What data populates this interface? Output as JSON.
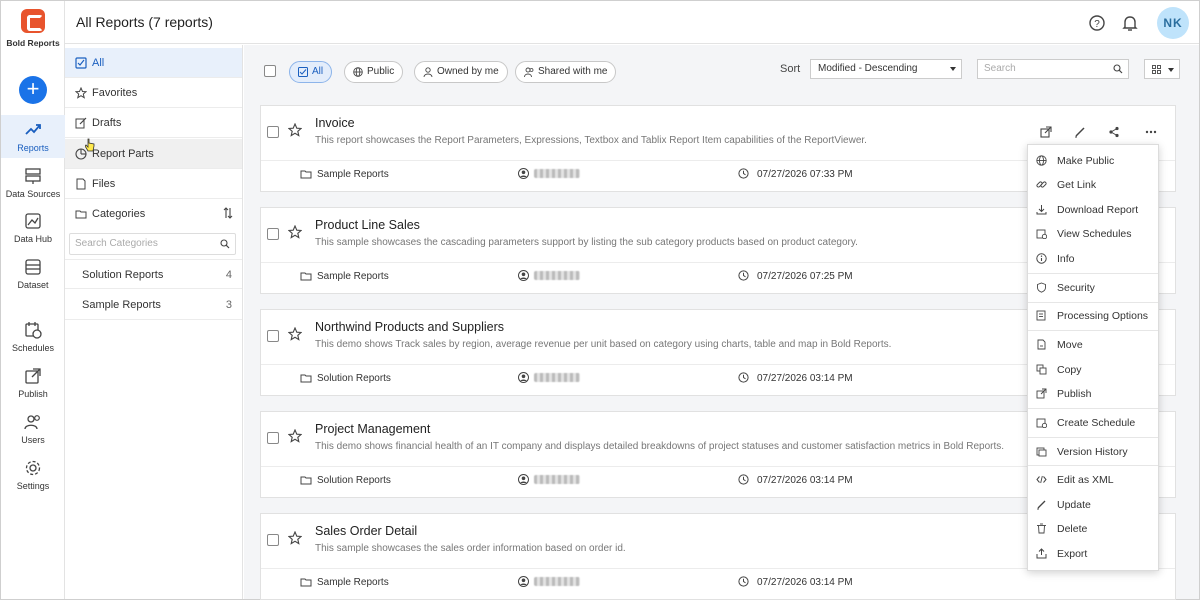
{
  "app": {
    "logo_text": "Bold Reports",
    "accent": "#1a73e8",
    "brand": "#e8542d"
  },
  "rail": {
    "items": [
      {
        "label": "Reports",
        "icon": "trending-up-icon",
        "active": true
      },
      {
        "label": "Data Sources",
        "icon": "data-sources-icon"
      },
      {
        "label": "Data Hub",
        "icon": "data-hub-icon"
      },
      {
        "label": "Dataset",
        "icon": "dataset-icon"
      },
      {
        "label": "Schedules",
        "icon": "schedules-icon"
      },
      {
        "label": "Publish",
        "icon": "publish-icon"
      },
      {
        "label": "Users",
        "icon": "users-icon"
      },
      {
        "label": "Settings",
        "icon": "gear-icon"
      }
    ]
  },
  "header": {
    "title": "All Reports (7 reports)",
    "avatar_initials": "NK"
  },
  "nav": {
    "items": [
      {
        "label": "All",
        "icon": "checkbox-icon"
      },
      {
        "label": "Favorites",
        "icon": "star-icon"
      },
      {
        "label": "Drafts",
        "icon": "edit-icon"
      },
      {
        "label": "Report Parts",
        "icon": "pie-icon"
      },
      {
        "label": "Files",
        "icon": "file-icon"
      },
      {
        "label": "Categories",
        "icon": "folder-icon"
      }
    ],
    "category_search_placeholder": "Search Categories",
    "categories": [
      {
        "name": "Solution Reports",
        "count": "4"
      },
      {
        "name": "Sample Reports",
        "count": "3"
      }
    ]
  },
  "toolbar": {
    "filters": [
      "All",
      "Public",
      "Owned by me",
      "Shared with me"
    ],
    "sort_label": "Sort",
    "sort_value": "Modified - Descending",
    "search_placeholder": "Search"
  },
  "reports": [
    {
      "title": "Invoice",
      "description": "This report showcases the Report Parameters, Expressions, Textbox and Tablix Report Item capabilities of the ReportViewer.",
      "category": "Sample Reports",
      "modified": "07/27/2026 07:33 PM"
    },
    {
      "title": "Product Line Sales",
      "description": "This sample showcases the cascading parameters support by listing the sub category products based on product category.",
      "category": "Sample Reports",
      "modified": "07/27/2026 07:25 PM"
    },
    {
      "title": "Northwind Products and Suppliers",
      "description": "This demo shows Track sales by region, average revenue per unit based on category using charts, table and map in Bold Reports.",
      "category": "Solution Reports",
      "modified": "07/27/2026 03:14 PM"
    },
    {
      "title": "Project Management",
      "description": "This demo shows financial health of an IT company and displays detailed breakdowns of project statuses and customer satisfaction metrics in Bold Reports.",
      "category": "Solution Reports",
      "modified": "07/27/2026 03:14 PM"
    },
    {
      "title": "Sales Order Detail",
      "description": "This sample showcases the sales order information based on order id.",
      "category": "Sample Reports",
      "modified": "07/27/2026 03:14 PM"
    }
  ],
  "context_menu": {
    "items": [
      "Make Public",
      "Get Link",
      "Download Report",
      "View Schedules",
      "Info",
      "Security",
      "Processing Options",
      "Move",
      "Copy",
      "Publish",
      "Create Schedule",
      "Version History",
      "Edit as XML",
      "Update",
      "Delete",
      "Export"
    ]
  }
}
